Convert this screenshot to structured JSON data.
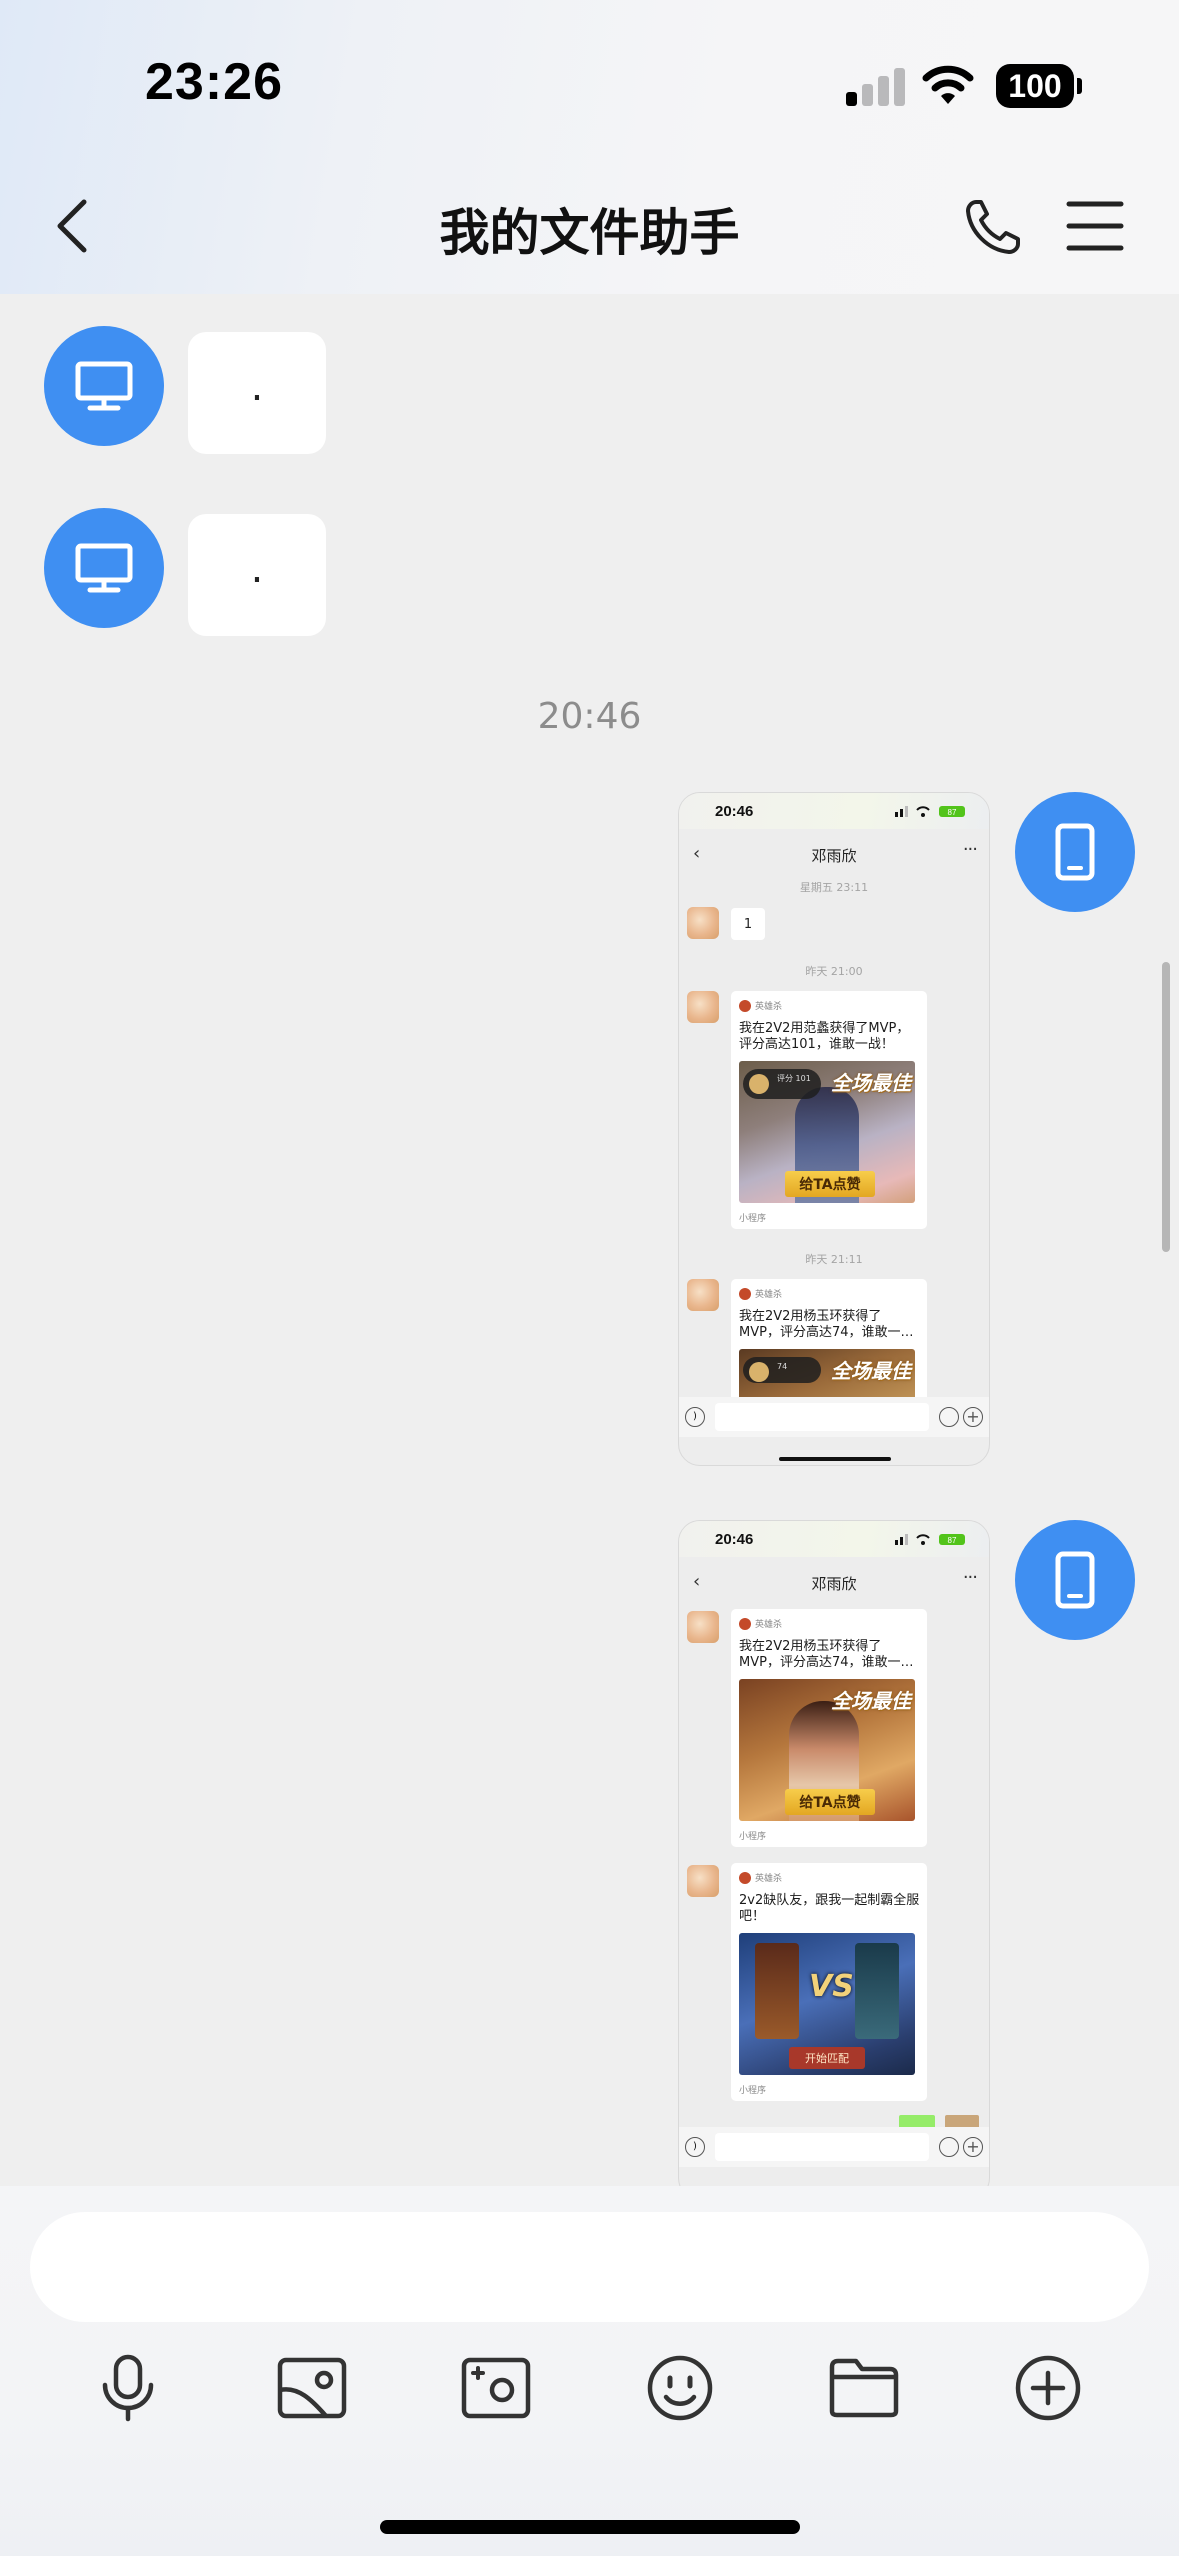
{
  "status_bar": {
    "time": "23:26",
    "battery": "100"
  },
  "nav": {
    "title": "我的文件助手"
  },
  "messages": [
    {
      "type": "text",
      "sender": "desktop",
      "text": "."
    },
    {
      "type": "text",
      "sender": "desktop",
      "text": "."
    }
  ],
  "timestamp": "20:46",
  "screenshot1": {
    "time": "20:46",
    "battery": "87",
    "title": "邓雨欣",
    "stamp1": "星期五 23:11",
    "msg1": "1",
    "stamp2": "昨天 21:00",
    "card1": {
      "source": "英雄杀",
      "text": "我在2V2用范蠡获得了MVP，评分高达101，谁敢一战！",
      "badge": "全场最佳",
      "score_label": "评分",
      "score": "101",
      "button": "给TA点赞",
      "footer": "小程序"
    },
    "stamp3": "昨天 21:11",
    "card2": {
      "source": "英雄杀",
      "text": "我在2V2用杨玉环获得了MVP，评分高达74，谁敢一…",
      "badge": "全场最佳",
      "score": "74"
    }
  },
  "screenshot2": {
    "time": "20:46",
    "battery": "87",
    "title": "邓雨欣",
    "card1": {
      "source": "英雄杀",
      "text": "我在2V2用杨玉环获得了MVP，评分高达74，谁敢一…",
      "badge": "全场最佳",
      "button": "给TA点赞",
      "footer": "小程序"
    },
    "card2": {
      "source": "英雄杀",
      "text": "2v2缺队友，跟我一起制霸全服吧！",
      "vs": "VS",
      "button": "开始匹配",
      "footer": "小程序"
    }
  },
  "toolbar": {
    "items": [
      "mic-icon",
      "image-icon",
      "camera-icon",
      "emoji-icon",
      "folder-icon",
      "plus-icon"
    ]
  },
  "colors": {
    "accent": "#3f8ff2",
    "background": "#efefef"
  }
}
